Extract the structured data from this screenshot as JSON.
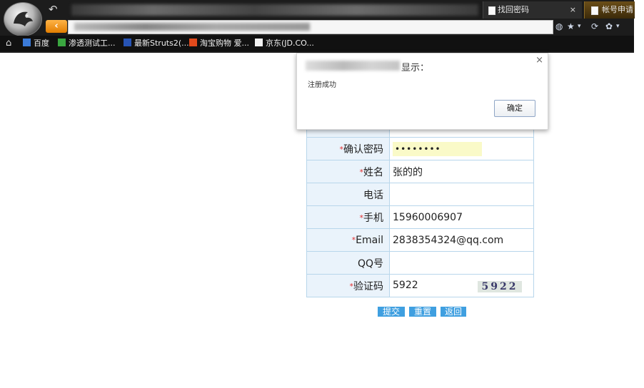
{
  "browser": {
    "tabs": [
      {
        "label": "找回密码",
        "close": "×"
      },
      {
        "label": "帐号申请"
      }
    ],
    "nav_back_glyph": "‹",
    "bookmarks": [
      {
        "label": "百度",
        "icon": "baidu-icon"
      },
      {
        "label": "渗透测试工...",
        "icon": "f-icon"
      },
      {
        "label": "最新Struts2(...",
        "icon": "struts-icon"
      },
      {
        "label": "淘宝购物 爱...",
        "icon": "taobao-icon"
      },
      {
        "label": "京东(JD.CO...",
        "icon": "page-icon"
      }
    ]
  },
  "form": {
    "rows": [
      {
        "label": "确认密码",
        "required": true,
        "value": "••••••••"
      },
      {
        "label": "姓名",
        "required": true,
        "value": "张的的"
      },
      {
        "label": "电话",
        "required": false,
        "value": ""
      },
      {
        "label": "手机",
        "required": true,
        "value": "15960006907"
      },
      {
        "label": "Email",
        "required": true,
        "value": "2838354324@qq.com"
      },
      {
        "label": "QQ号",
        "required": false,
        "value": ""
      },
      {
        "label": "验证码",
        "required": true,
        "value": "5922",
        "captcha": "5922"
      }
    ],
    "required_mark": "*",
    "buttons": {
      "submit": "提交",
      "reset": "重置",
      "back": "返回"
    }
  },
  "dialog": {
    "title": "显示：",
    "message": "注册成功",
    "ok_label": "确定",
    "close_glyph": "×"
  },
  "colors": {
    "label_bg": "#eaf3fb",
    "border": "#b8d6eb",
    "button": "#3f9fe0",
    "required": "#e23030"
  }
}
